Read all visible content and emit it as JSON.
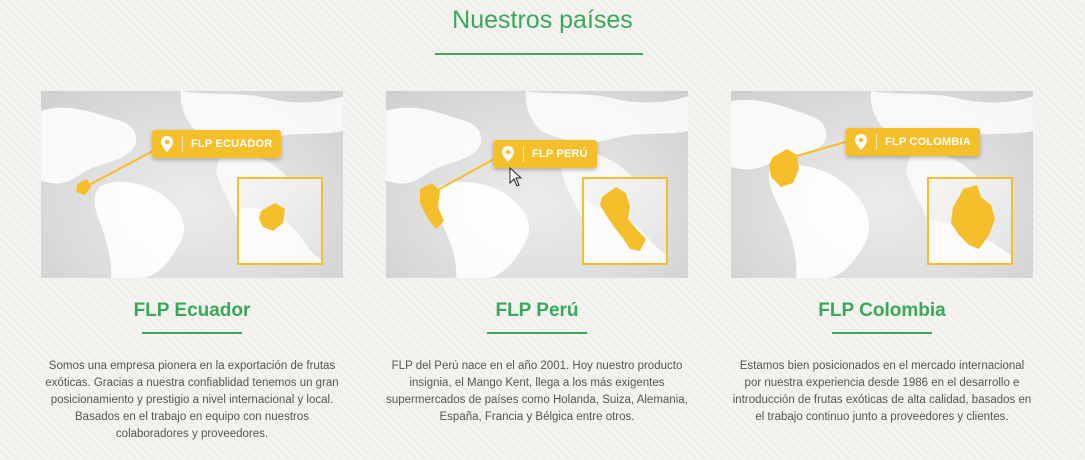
{
  "section": {
    "title": "Nuestros países"
  },
  "colors": {
    "accent": "#3aa85a",
    "pin": "#f5be2b",
    "text": "#555555"
  },
  "cards": [
    {
      "pin_label": "FLP ECUADOR",
      "title": "FLP Ecuador",
      "text": "Somos una empresa pionera en la exportación de frutas exóticas. Gracias a nuestra confiablidad tenemos un gran posicionamiento y prestigio a nivel internacional y local. Basados en el trabajo en equipo con nuestros colaboradores y proveedores."
    },
    {
      "pin_label": "FLP PERÚ",
      "title": "FLP Perú",
      "text": "FLP del Perú nace en el año 2001. Hoy nuestro producto insignia, el Mango Kent, llega a los más exigentes supermercados de países como Holanda, Suiza, Alemania, España, Francia y Bélgica entre otros."
    },
    {
      "pin_label": "FLP COLOMBIA",
      "title": "FLP Colombia",
      "text": "Estamos bien posicionados en el mercado internacional por nuestra experiencia desde 1986 en el desarrollo e introducción de frutas exóticas de alta calidad, basados en el trabajo continuo junto a proveedores y clientes."
    }
  ],
  "icons": {
    "pin": "map-marker-icon",
    "cursor": "mouse-pointer-icon"
  }
}
